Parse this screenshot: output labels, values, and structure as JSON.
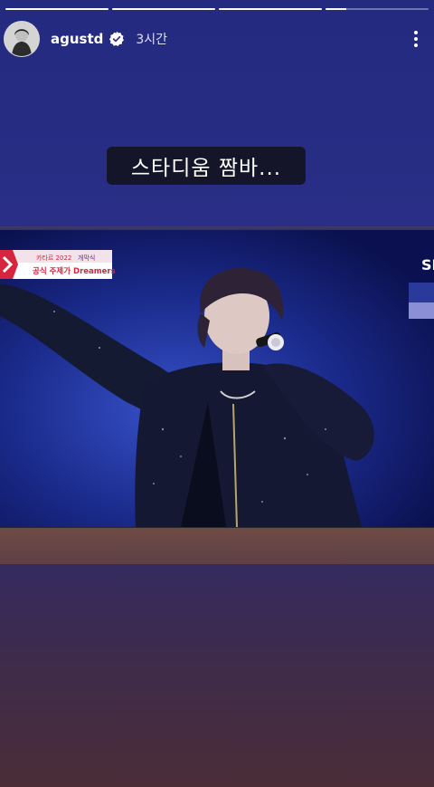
{
  "story": {
    "progress": [
      1,
      1,
      1,
      0.2
    ],
    "username": "agustd",
    "time": "3시간",
    "caption": "스타디움 짬바...",
    "tv_overlay": {
      "event_line_prefix": "카타르 2022",
      "event_line_highlight": "개막식",
      "song_line": "공식 주제가 Dreamers",
      "channel_logo": "SE"
    }
  },
  "colors": {
    "background_top": "#232a7f",
    "background_bottom": "#4a2d37",
    "caption_bg": "#14142380",
    "accent_red": "#d6253f"
  },
  "icons": {
    "verified": "verified-badge-icon",
    "more": "more-vertical-icon"
  }
}
